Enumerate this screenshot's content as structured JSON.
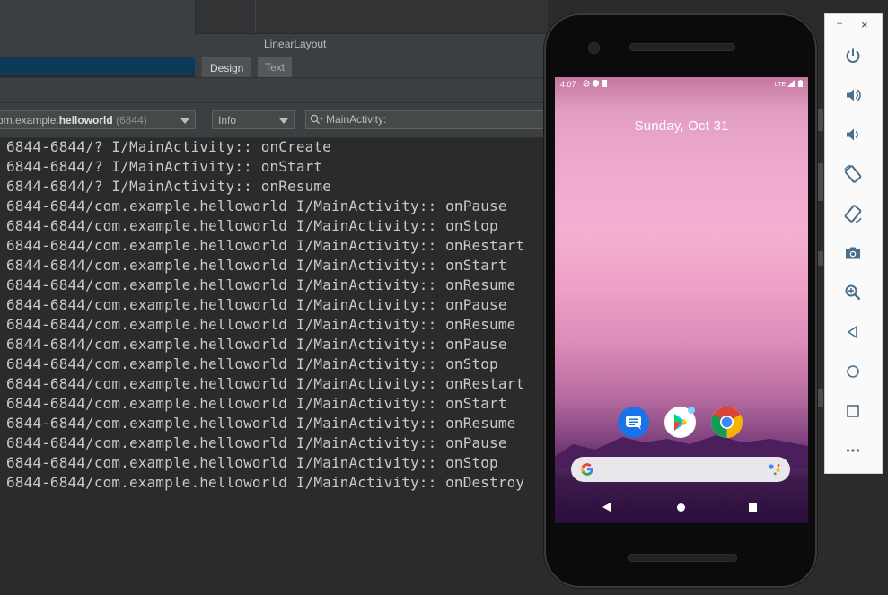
{
  "ide": {
    "layout_title": "LinearLayout",
    "tabs": [
      {
        "label": "Design"
      },
      {
        "label": "Text"
      }
    ]
  },
  "logcat": {
    "device_prefix": "om.example.",
    "device_bold": "helloworld",
    "device_pid": "(6844)",
    "level": "Info",
    "search_value": "MainActivity:",
    "lines": [
      "6844-6844/? I/MainActivity:: onCreate",
      "6844-6844/? I/MainActivity:: onStart",
      "6844-6844/? I/MainActivity:: onResume",
      "6844-6844/com.example.helloworld I/MainActivity:: onPause",
      "6844-6844/com.example.helloworld I/MainActivity:: onStop",
      "6844-6844/com.example.helloworld I/MainActivity:: onRestart",
      "6844-6844/com.example.helloworld I/MainActivity:: onStart",
      "6844-6844/com.example.helloworld I/MainActivity:: onResume",
      "6844-6844/com.example.helloworld I/MainActivity:: onPause",
      "6844-6844/com.example.helloworld I/MainActivity:: onResume",
      "6844-6844/com.example.helloworld I/MainActivity:: onPause",
      "6844-6844/com.example.helloworld I/MainActivity:: onStop",
      "6844-6844/com.example.helloworld I/MainActivity:: onRestart",
      "6844-6844/com.example.helloworld I/MainActivity:: onStart",
      "6844-6844/com.example.helloworld I/MainActivity:: onResume",
      "6844-6844/com.example.helloworld I/MainActivity:: onPause",
      "6844-6844/com.example.helloworld I/MainActivity:: onStop",
      "6844-6844/com.example.helloworld I/MainActivity:: onDestroy"
    ]
  },
  "phone": {
    "status_time": "4:07",
    "status_network": "LTE",
    "date": "Sunday, Oct 31",
    "apps": [
      {
        "name": "messages",
        "icon": "messages-icon"
      },
      {
        "name": "play-store",
        "icon": "play-store-icon"
      },
      {
        "name": "chrome",
        "icon": "chrome-icon"
      }
    ],
    "search_icons": [
      "google-g-icon",
      "google-assistant-icon"
    ],
    "nav": [
      "back-icon",
      "home-icon",
      "recents-icon"
    ]
  },
  "emulator_panel": {
    "minimize_label": "–",
    "close_label": "×",
    "buttons": [
      {
        "name": "power-button",
        "icon": "power-icon"
      },
      {
        "name": "volume-up-button",
        "icon": "volume-up-icon"
      },
      {
        "name": "volume-down-button",
        "icon": "volume-down-icon"
      },
      {
        "name": "rotate-left-button",
        "icon": "rotate-left-icon"
      },
      {
        "name": "rotate-right-button",
        "icon": "rotate-right-icon"
      },
      {
        "name": "screenshot-button",
        "icon": "camera-icon"
      },
      {
        "name": "zoom-button",
        "icon": "zoom-in-icon"
      },
      {
        "name": "back-button",
        "icon": "back-triangle-icon"
      },
      {
        "name": "home-button",
        "icon": "home-circle-icon"
      },
      {
        "name": "overview-button",
        "icon": "overview-square-icon"
      },
      {
        "name": "more-button",
        "icon": "more-icon"
      }
    ]
  },
  "colors": {
    "ide_bg": "#2b2b2b",
    "panel_icon": "#4a6f8a",
    "log_text": "#c9c9c9"
  }
}
